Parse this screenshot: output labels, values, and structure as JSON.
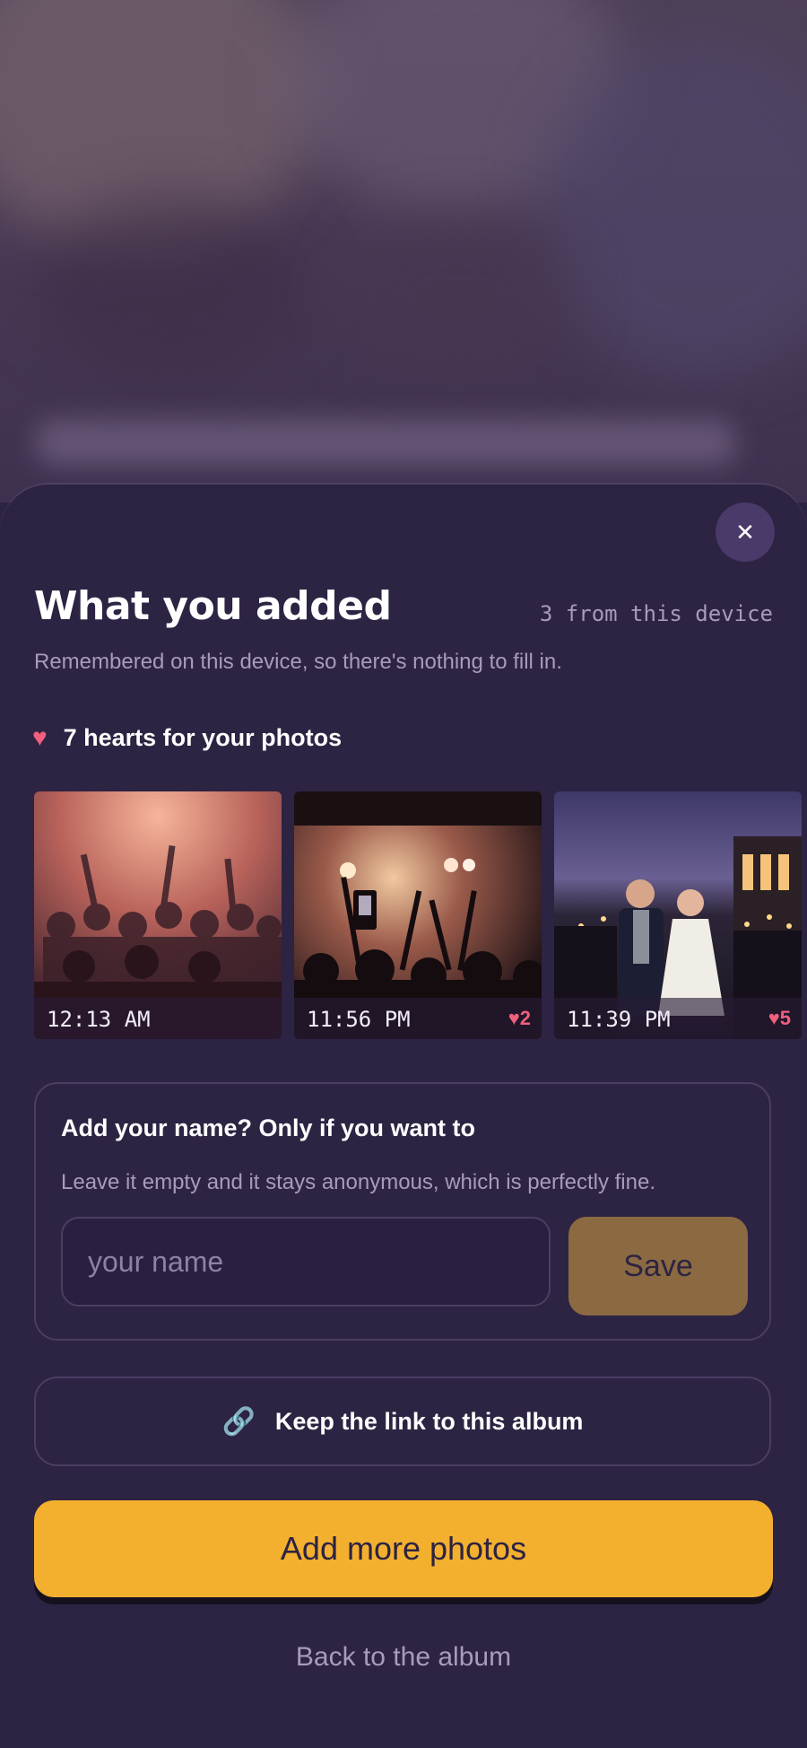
{
  "sheet": {
    "close_icon_glyph": "✕",
    "title": "What you added",
    "device_count": "3 from this device",
    "subtitle": "Remembered on this device, so there's nothing to fill in.",
    "hearts_summary": "7 hearts for your photos",
    "heart_glyph": "♥"
  },
  "photos": [
    {
      "time": "12:13 AM",
      "likes": "",
      "scene": "party crowd"
    },
    {
      "time": "11:56 PM",
      "likes": "♥2",
      "scene": "concert stage"
    },
    {
      "time": "11:39 PM",
      "likes": "♥5",
      "scene": "wedding couple"
    }
  ],
  "name_form": {
    "heading": "Add your name? Only if you want to",
    "description": "Leave it empty and it stays anonymous, which is perfectly fine.",
    "placeholder": "your name",
    "value": "",
    "save_label": "Save"
  },
  "link_action": {
    "icon": "link-icon",
    "icon_glyph": "🔗",
    "label": "Keep the link to this album"
  },
  "primary_action": {
    "label": "Add more photos"
  },
  "secondary_action": {
    "label": "Back to the album"
  },
  "colors": {
    "background": "#2d2342",
    "accent": "#f3b02f",
    "save_button": "#8b6a42",
    "heart": "#f05f7e",
    "muted_text": "#a89bbd"
  }
}
